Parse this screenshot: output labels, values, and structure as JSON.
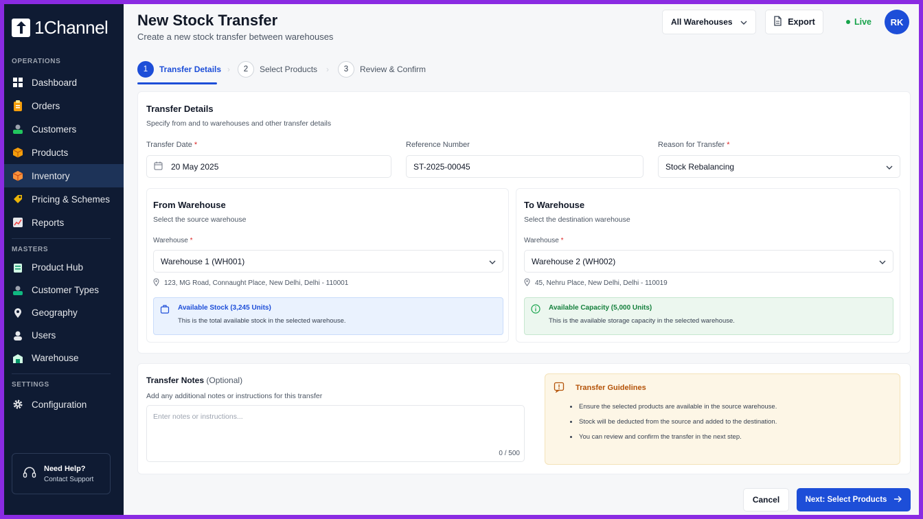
{
  "app": {
    "name": "1Channel"
  },
  "sidebar": {
    "sections": [
      {
        "label": "OPERATIONS",
        "items": [
          {
            "label": "Dashboard",
            "icon": "dashboard-icon"
          },
          {
            "label": "Orders",
            "icon": "clipboard-icon"
          },
          {
            "label": "Customers",
            "icon": "customers-icon"
          },
          {
            "label": "Products",
            "icon": "box-icon"
          },
          {
            "label": "Inventory",
            "icon": "inventory-icon",
            "active": true
          },
          {
            "label": "Pricing & Schemes",
            "icon": "tag-icon"
          },
          {
            "label": "Reports",
            "icon": "chart-icon"
          }
        ]
      },
      {
        "label": "MASTERS",
        "items": [
          {
            "label": "Product Hub",
            "icon": "product-hub-icon"
          },
          {
            "label": "Customer Types",
            "icon": "customer-types-icon"
          },
          {
            "label": "Geography",
            "icon": "map-pin-icon"
          },
          {
            "label": "Users",
            "icon": "users-icon"
          },
          {
            "label": "Warehouse",
            "icon": "warehouse-icon"
          }
        ]
      },
      {
        "label": "SETTINGS",
        "items": [
          {
            "label": "Configuration",
            "icon": "gear-icon"
          }
        ]
      }
    ],
    "help": {
      "title": "Need Help?",
      "subtitle": "Contact Support"
    }
  },
  "header": {
    "title": "New Stock Transfer",
    "subtitle": "Create a new stock transfer between warehouses",
    "warehouse_filter": "All Warehouses",
    "export_label": "Export",
    "live_label": "Live",
    "avatar_initials": "RK"
  },
  "stepper": [
    {
      "num": "1",
      "label": "Transfer Details",
      "active": true
    },
    {
      "num": "2",
      "label": "Select Products"
    },
    {
      "num": "3",
      "label": "Review & Confirm"
    }
  ],
  "details": {
    "title": "Transfer Details",
    "subtitle": "Specify from and to warehouses and other transfer details",
    "date_label": "Transfer Date",
    "date_value": "20 May 2025",
    "ref_label": "Reference Number",
    "ref_value": "ST-2025-00045",
    "reason_label": "Reason for Transfer",
    "reason_value": "Stock Rebalancing"
  },
  "from": {
    "title": "From Warehouse",
    "subtitle": "Select the source warehouse",
    "field_label": "Warehouse",
    "value": "Warehouse 1 (WH001)",
    "address": "123, MG Road, Connaught Place, New Delhi, Delhi - 110001",
    "info_title": "Available Stock (3,245 Units)",
    "info_text": "This is the total available stock in the selected warehouse."
  },
  "to": {
    "title": "To Warehouse",
    "subtitle": "Select the destination warehouse",
    "field_label": "Warehouse",
    "value": "Warehouse 2 (WH002)",
    "address": "45, Nehru Place, New Delhi, Delhi - 110019",
    "info_title": "Available Capacity (5,000 Units)",
    "info_text": "This is the available storage capacity in the selected warehouse."
  },
  "notes": {
    "title": "Transfer Notes",
    "optional": "(Optional)",
    "subtitle": "Add any additional notes or instructions for this transfer",
    "placeholder": "Enter notes or instructions...",
    "counter": "0 / 500"
  },
  "guidelines": {
    "title": "Transfer Guidelines",
    "items": [
      "Ensure the selected products are available in the source warehouse.",
      "Stock will be deducted from the source and added to the destination.",
      "You can review and confirm the transfer in the next step."
    ]
  },
  "footer": {
    "cancel_label": "Cancel",
    "next_label": "Next: Select Products"
  },
  "colors": {
    "primary": "#1d4ed8",
    "sidebar_bg": "#0f1b33",
    "live": "#16a34a",
    "frame": "#8a2be2"
  }
}
